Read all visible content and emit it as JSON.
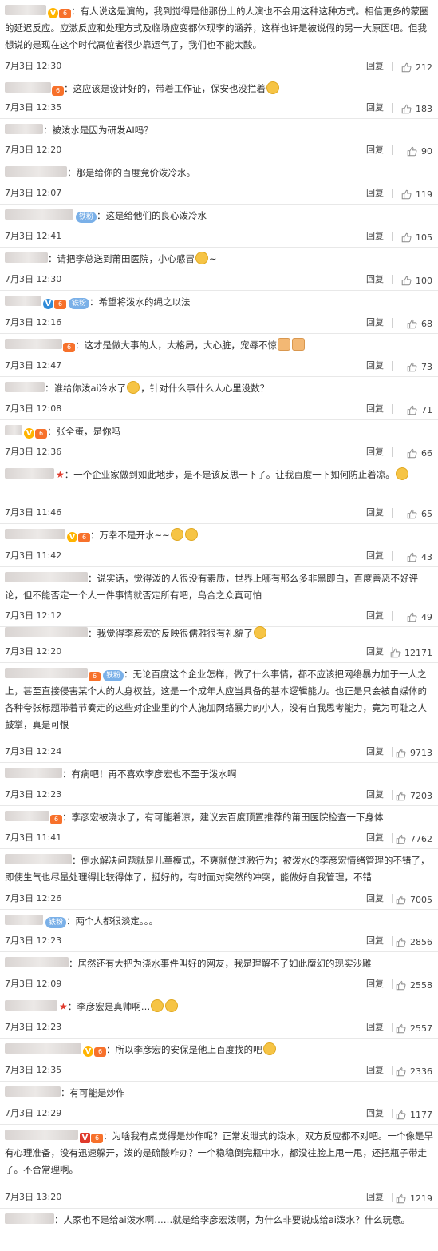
{
  "labels": {
    "reply": "回复"
  },
  "comments": [
    {
      "prefix": "：",
      "text": "有人说这是演的，我到觉得是他那份上的人演也不会用这种这种方式。相信更多的蒙圈的延迟反应。应激反应和处理方式及临场应变都体现李的涵养，这样也许是被说假的另一大原因吧。但我想说的是现在这个时代高位者很少靠运气了，我们也不能太酸。",
      "time": "7月3日 12:30",
      "likes": "212"
    },
    {
      "prefix": "：",
      "text": "这应该是设计好的，带着工作证，保安也没拦着",
      "time": "7月3日 12:35",
      "likes": "183"
    },
    {
      "prefix": "：",
      "text": "被泼水是因为研发AI吗？",
      "time": "7月3日 12:20",
      "likes": "90"
    },
    {
      "prefix": "：",
      "text": "那是给你的百度竞价泼冷水。",
      "time": "7月3日 12:07",
      "likes": "119"
    },
    {
      "badge": "铁粉",
      "prefix": "：",
      "text": "这是给他们的良心泼冷水",
      "time": "7月3日 12:41",
      "likes": "105"
    },
    {
      "prefix": "：",
      "text": "请把李总送到莆田医院，小心感冒",
      "text_after": "~",
      "time": "7月3日 12:30",
      "likes": "100"
    },
    {
      "badge": "铁粉",
      "prefix": "：",
      "text": "希望将泼水的绳之以法",
      "time": "7月3日 12:16",
      "likes": "68"
    },
    {
      "prefix": "：",
      "text": "这才是做大事的人，大格局，大心脏，宠辱不惊",
      "time": "7月3日 12:47",
      "likes": "73"
    },
    {
      "prefix": "：",
      "text": "谁给你泼ai冷水了",
      "text_after": "，针对什么事什么人心里没数？",
      "time": "7月3日 12:08",
      "likes": "71"
    },
    {
      "prefix": "：",
      "text": "张全蛋，是你吗",
      "time": "7月3日 12:36",
      "likes": "66"
    },
    {
      "prefix": "：",
      "text": "一个企业家做到如此地步，是不是该反思一下了。让我百度一下如何防止着凉。",
      "time": "7月3日 11:46",
      "likes": "65"
    },
    {
      "prefix": "：",
      "text": "万幸不是开水~~",
      "time": "7月3日 11:42",
      "likes": "43"
    },
    {
      "prefix": "：",
      "text": "说实话，觉得泼的人很没有素质，世界上哪有那么多非黑即白，百度善恶不好评论，但不能否定一个人一件事情就否定所有吧，乌合之众真可怕",
      "time": "7月3日 12:12",
      "likes": "49"
    },
    {
      "prefix": "：",
      "text": "我觉得李彦宏的反映很儒雅很有礼貌了",
      "time": "7月3日 12:20",
      "likes": "12171"
    },
    {
      "badge": "铁粉",
      "prefix": "：",
      "text": "无论百度这个企业怎样，做了什么事情，都不应该把网络暴力加于一人之上，甚至直接侵害某个人的人身权益，这是一个成年人应当具备的基本逻辑能力。也正是只会被自媒体的各种夸张标题带着节奏走的这些对企业里的个人施加网络暴力的小人，没有自我思考能力，竟为可耻之人鼓掌，真是可恨",
      "time": "7月3日 12:24",
      "likes": "9713"
    },
    {
      "prefix": "：",
      "text": "有病吧！再不喜欢李彦宏也不至于泼水啊",
      "time": "7月3日 12:23",
      "likes": "7203"
    },
    {
      "prefix": "：",
      "text": "李彦宏被浇水了，有可能着凉，建议去百度顶置推荐的莆田医院检查一下身体",
      "time": "7月3日 11:41",
      "likes": "7762"
    },
    {
      "prefix": "：",
      "text": "倒水解决问题就是儿童模式，不爽就做过激行为；被泼水的李彦宏情绪管理的不错了，即使生气也尽量处理得比较得体了，挺好的，有时面对突然的冲突，能做好自我管理，不错",
      "time": "7月3日 12:26",
      "likes": "7005"
    },
    {
      "badge": "铁粉",
      "prefix": "：",
      "text": "两个人都很淡定。。。",
      "time": "7月3日 12:23",
      "likes": "2856"
    },
    {
      "prefix": "：",
      "text": "居然还有大把为浇水事件叫好的网友，我是理解不了如此魔幻的现实沙雕",
      "time": "7月3日 12:09",
      "likes": "2558"
    },
    {
      "prefix": "：",
      "text": "李彦宏是真帅啊…",
      "time": "7月3日 12:23",
      "likes": "2557"
    },
    {
      "prefix": "：",
      "text": "所以李彦宏的安保是他上百度找的吧",
      "time": "7月3日 12:35",
      "likes": "2336"
    },
    {
      "prefix": "：",
      "text": "有可能是炒作",
      "time": "7月3日 12:29",
      "likes": "1177"
    },
    {
      "prefix": "：",
      "text": "为啥我有点觉得是炒作呢？正常发泄式的泼水，双方反应都不对吧。一个像是早有心理准备，没有迅速躲开，泼的是硫酸咋办？一个稳稳倒完瓶中水，都没往脸上甩一甩，还把瓶子带走了。不合常理啊。",
      "time": "7月3日 13:20",
      "likes": "1219"
    },
    {
      "prefix": "：",
      "text": "人家也不是给ai泼水啊……就是给李彦宏泼啊，为什么非要说成给ai泼水？什么玩意。",
      "time": "",
      "likes": ""
    }
  ]
}
